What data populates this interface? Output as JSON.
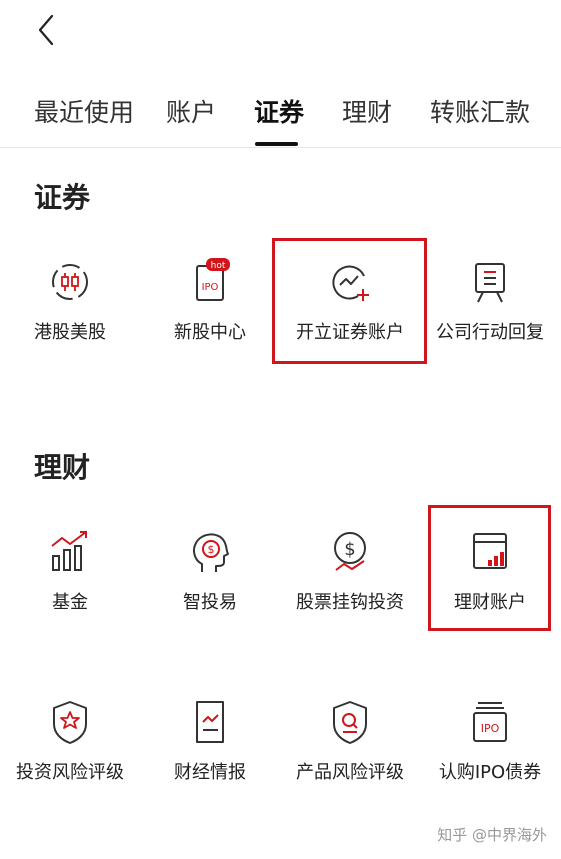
{
  "tabs": [
    {
      "label": "最近使用"
    },
    {
      "label": "账户"
    },
    {
      "label": "证券"
    },
    {
      "label": "理财"
    },
    {
      "label": "转账汇款"
    }
  ],
  "active_tab": "证券",
  "sections": [
    {
      "title": "证券",
      "items": [
        {
          "label": "港股美股",
          "icon": "hk-us-stock-icon"
        },
        {
          "label": "新股中心",
          "icon": "ipo-hot-icon",
          "badge": "hot"
        },
        {
          "label": "开立证券账户",
          "icon": "open-securities-account-icon"
        },
        {
          "label": "公司行动回复",
          "icon": "corporate-action-board-icon"
        }
      ]
    },
    {
      "title": "理财",
      "items": [
        {
          "label": "基金",
          "icon": "fund-chart-icon"
        },
        {
          "label": "智投易",
          "icon": "robo-advisor-head-icon"
        },
        {
          "label": "股票挂钩投资",
          "icon": "equity-linked-dollar-icon"
        },
        {
          "label": "理财账户",
          "icon": "wealth-account-card-icon"
        }
      ]
    },
    {
      "items": [
        {
          "label": "投资风险评级",
          "icon": "investment-risk-shield-icon"
        },
        {
          "label": "财经情报",
          "icon": "finance-news-doc-icon"
        },
        {
          "label": "产品风险评级",
          "icon": "product-risk-search-icon"
        },
        {
          "label": "认购IPO债券",
          "icon": "ipo-bond-stack-icon"
        }
      ]
    }
  ],
  "icon_badge_text": {
    "ipo_doc": "IPO",
    "ipo_stack": "IPO"
  },
  "watermark": "知乎 @中界海外",
  "colors": {
    "accent": "#d0161a",
    "text": "#222222",
    "icon_stroke": "#333333"
  }
}
